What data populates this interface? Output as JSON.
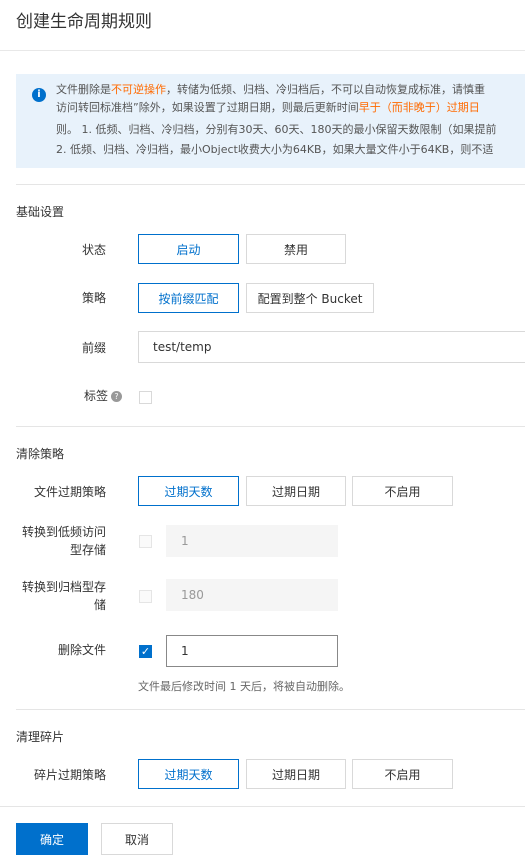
{
  "page": {
    "title": "创建生命周期规则"
  },
  "notice": {
    "line1_a": "文件删除是",
    "line1_b": "不可逆操作",
    "line1_c": "，转储为低频、归档、冷归档后，不可以自动恢复成标准，请慎重",
    "line2_a": "访问转回标准档”除外，如果设置了过期日期，则最后更新时间",
    "line2_b": "早于（而非晚于）过期日",
    "line3": "则。 1. 低频、归档、冷归档，分别有30天、60天、180天的最小保留天数限制（如果提前",
    "line4": "2. 低频、归档、冷归档，最小Object收费大小为64KB，如果大量文件小于64KB，则不适"
  },
  "basic": {
    "section_title": "基础设置",
    "status_label": "状态",
    "status_options": [
      "启动",
      "禁用"
    ],
    "status_selected": "启动",
    "policy_label": "策略",
    "policy_options": [
      "按前缀匹配",
      "配置到整个 Bucket"
    ],
    "policy_selected": "按前缀匹配",
    "prefix_label": "前缀",
    "prefix_value": "test/temp",
    "tag_label": "标签",
    "tag_help_icon": "question-circle-icon",
    "tag_checked": false
  },
  "clear": {
    "section_title": "清除策略",
    "file_expire_label": "文件过期策略",
    "file_expire_options": [
      "过期天数",
      "过期日期",
      "不启用"
    ],
    "file_expire_selected": "过期天数",
    "ia_label_line1": "转换到低频访问",
    "ia_label_line2": "型存储",
    "ia_checked": false,
    "ia_days": "1",
    "archive_label_line1": "转换到归档型存",
    "archive_label_line2": "储",
    "archive_checked": false,
    "archive_days": "180",
    "delete_label": "删除文件",
    "delete_checked": true,
    "delete_days": "1",
    "delete_hint": "文件最后修改时间 1 天后，将被自动删除。"
  },
  "fragments": {
    "section_title": "清理碎片",
    "expire_label": "碎片过期策略",
    "expire_options": [
      "过期天数",
      "过期日期",
      "不启用"
    ],
    "expire_selected": "过期天数"
  },
  "footer": {
    "confirm_label": "确定",
    "cancel_label": "取消"
  },
  "colors": {
    "accent": "#0070cc",
    "warning_text": "#ff6a00",
    "notice_bg": "#e8f2fb"
  }
}
